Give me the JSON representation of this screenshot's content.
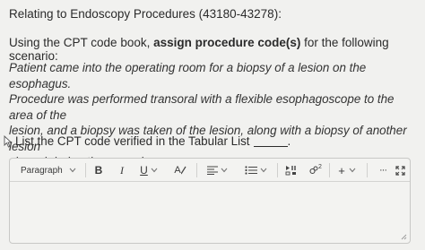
{
  "header": {
    "title": "Relating to Endoscopy Procedures (43180-43278):"
  },
  "instruction": {
    "prefix": "Using the CPT code book, ",
    "bold": "assign procedure code(s)",
    "suffix": " for the following scenario:"
  },
  "scenario": {
    "line1": "Patient came into the operating room for a biopsy of a lesion on the esophagus.",
    "line2": "Procedure was performed transoral with a flexible esophagoscope to the area of the",
    "line3": "lesion, and a biopsy was taken of the lesion, along with a biopsy of another lesion",
    "line4": "viewed during the procedure."
  },
  "question": {
    "text": "List the CPT code verified in the Tabular List",
    "end": "."
  },
  "toolbar": {
    "paragraph_label": "Paragraph",
    "bold_label": "B",
    "italic_label": "I",
    "underline_label": "U",
    "text_color_label": "A",
    "superscript_label": "2",
    "add_label": "+",
    "more_label": "···"
  },
  "editor": {
    "value": ""
  }
}
